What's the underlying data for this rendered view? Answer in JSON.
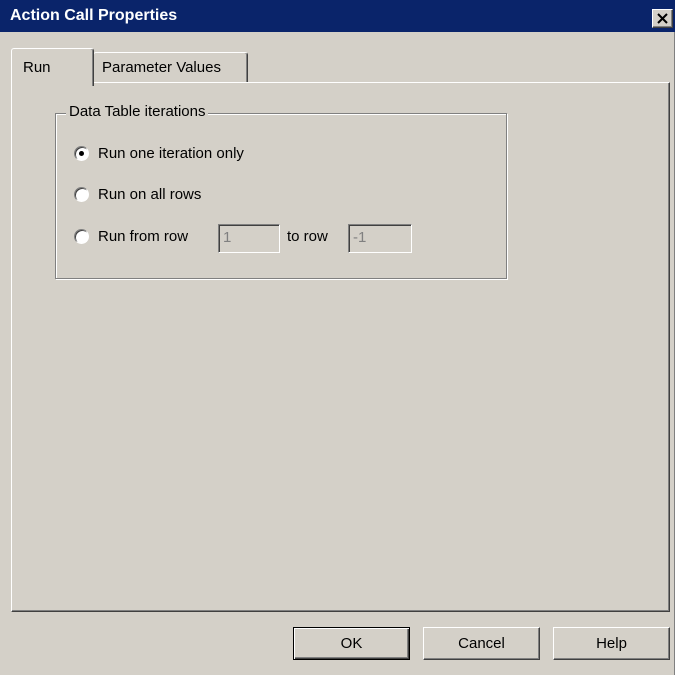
{
  "window": {
    "title": "Action Call Properties",
    "colors": {
      "titlebar": "#0a246a",
      "face": "#d4d0c8"
    }
  },
  "close_icon": "close-icon",
  "tabs": [
    {
      "label": "Run",
      "active": true
    },
    {
      "label": "Parameter Values",
      "active": false
    }
  ],
  "group": {
    "legend": "Data Table iterations",
    "options": [
      {
        "label": "Run one iteration only",
        "selected": true
      },
      {
        "label": "Run on all rows",
        "selected": false
      },
      {
        "label": "Run from row",
        "selected": false
      }
    ],
    "from_row_value": "1",
    "to_row_label": "to row",
    "to_row_value": "-1"
  },
  "buttons": {
    "ok": "OK",
    "cancel": "Cancel",
    "help": "Help"
  }
}
